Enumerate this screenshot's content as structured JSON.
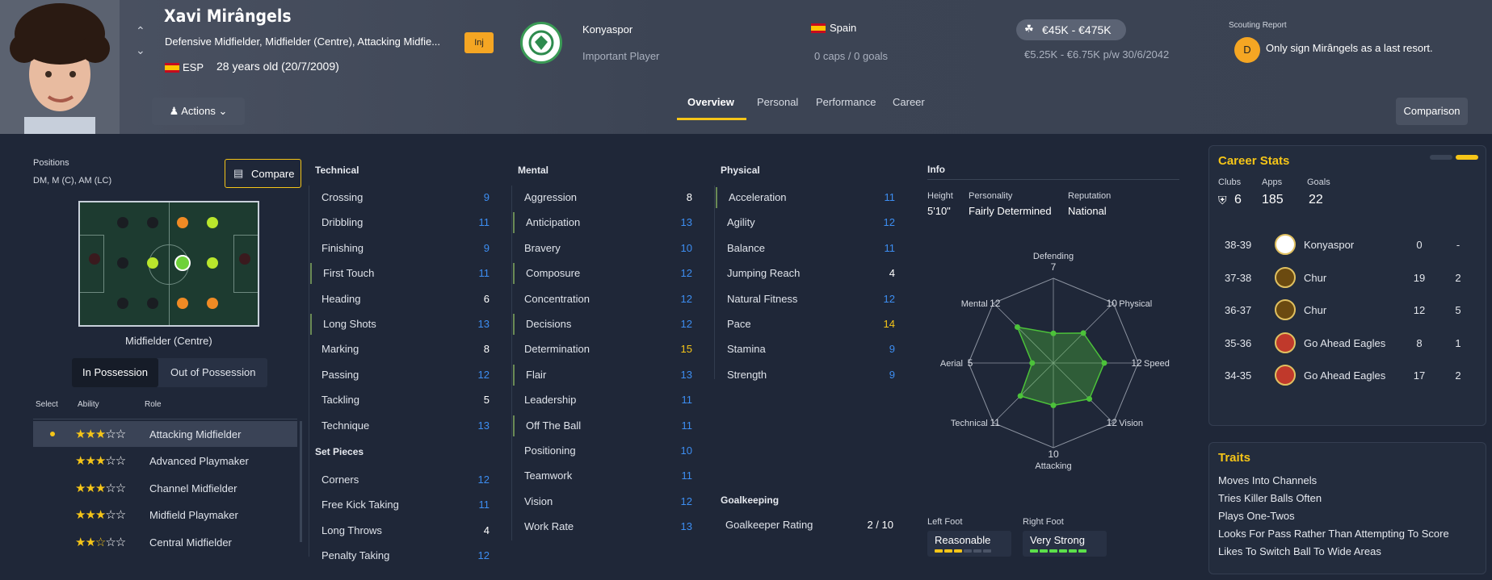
{
  "header": {
    "player_name": "Xavi Mirângels",
    "positions_long": "Defensive Midfielder, Midfielder (Centre), Attacking Midfie...",
    "inj_badge": "Inj",
    "nationality_code": "ESP",
    "age": "28 years old (20/7/2009)",
    "club": "Konyaspor",
    "club_role": "Important Player",
    "nation": "Spain",
    "caps": "0 caps / 0 goals",
    "value": "€45K - €475K",
    "wage": "€5.25K - €6.75K p/w 30/6/2042",
    "scouting_title": "Scouting Report",
    "scout_grade": "D",
    "scout_text": "Only sign Mirângels as a last resort.",
    "actions_label": "Actions",
    "comparison_label": "Comparison",
    "tabs": [
      "Overview",
      "Personal",
      "Performance",
      "Career"
    ]
  },
  "positions": {
    "title": "Positions",
    "list": "DM, M (C), AM (LC)",
    "compare_label": "Compare",
    "current": "Midfielder (Centre)",
    "toggle": [
      "In Possession",
      "Out of Possession"
    ]
  },
  "roles": {
    "headers": [
      "Select",
      "Ability",
      "Role"
    ],
    "items": [
      {
        "name": "Attacking Midfielder",
        "stars": 3
      },
      {
        "name": "Advanced Playmaker",
        "stars": 3
      },
      {
        "name": "Channel Midfielder",
        "stars": 3
      },
      {
        "name": "Midfield Playmaker",
        "stars": 3
      },
      {
        "name": "Central Midfielder",
        "stars": 2.5
      }
    ]
  },
  "technical": {
    "title": "Technical",
    "items": [
      {
        "name": "Crossing",
        "value": "9"
      },
      {
        "name": "Dribbling",
        "value": "11"
      },
      {
        "name": "Finishing",
        "value": "9"
      },
      {
        "name": "First Touch",
        "value": "11"
      },
      {
        "name": "Heading",
        "value": "6"
      },
      {
        "name": "Long Shots",
        "value": "13"
      },
      {
        "name": "Marking",
        "value": "8"
      },
      {
        "name": "Passing",
        "value": "12"
      },
      {
        "name": "Tackling",
        "value": "5"
      },
      {
        "name": "Technique",
        "value": "13"
      }
    ]
  },
  "set_pieces": {
    "title": "Set Pieces",
    "items": [
      {
        "name": "Corners",
        "value": "12"
      },
      {
        "name": "Free Kick Taking",
        "value": "11"
      },
      {
        "name": "Long Throws",
        "value": "4"
      },
      {
        "name": "Penalty Taking",
        "value": "12"
      }
    ]
  },
  "mental": {
    "title": "Mental",
    "items": [
      {
        "name": "Aggression",
        "value": "8"
      },
      {
        "name": "Anticipation",
        "value": "13"
      },
      {
        "name": "Bravery",
        "value": "10"
      },
      {
        "name": "Composure",
        "value": "12"
      },
      {
        "name": "Concentration",
        "value": "12"
      },
      {
        "name": "Decisions",
        "value": "12"
      },
      {
        "name": "Determination",
        "value": "15"
      },
      {
        "name": "Flair",
        "value": "13"
      },
      {
        "name": "Leadership",
        "value": "11"
      },
      {
        "name": "Off The Ball",
        "value": "11"
      },
      {
        "name": "Positioning",
        "value": "10"
      },
      {
        "name": "Teamwork",
        "value": "11"
      },
      {
        "name": "Vision",
        "value": "12"
      },
      {
        "name": "Work Rate",
        "value": "13"
      }
    ]
  },
  "physical": {
    "title": "Physical",
    "items": [
      {
        "name": "Acceleration",
        "value": "11"
      },
      {
        "name": "Agility",
        "value": "12"
      },
      {
        "name": "Balance",
        "value": "11"
      },
      {
        "name": "Jumping Reach",
        "value": "4"
      },
      {
        "name": "Natural Fitness",
        "value": "12"
      },
      {
        "name": "Pace",
        "value": "14"
      },
      {
        "name": "Stamina",
        "value": "9"
      },
      {
        "name": "Strength",
        "value": "9"
      }
    ]
  },
  "goalkeeping": {
    "title": "Goalkeeping",
    "label": "Goalkeeper Rating",
    "value": "2 / 10"
  },
  "info": {
    "title": "Info",
    "height_label": "Height",
    "height": "5'10\"",
    "personality_label": "Personality",
    "personality": "Fairly Determined",
    "reputation_label": "Reputation",
    "reputation": "National",
    "left_foot_label": "Left Foot",
    "left_foot": "Reasonable",
    "left_foot_level": 3,
    "right_foot_label": "Right Foot",
    "right_foot": "Very Strong",
    "right_foot_level": 6
  },
  "radar": {
    "axes": [
      {
        "name": "Defending",
        "value": 7
      },
      {
        "name": "Physical",
        "value": 10
      },
      {
        "name": "Speed",
        "value": 12
      },
      {
        "name": "Vision",
        "value": 12
      },
      {
        "name": "Attacking",
        "value": 10
      },
      {
        "name": "Technical",
        "value": 11
      },
      {
        "name": "Aerial",
        "value": 5
      },
      {
        "name": "Mental",
        "value": 12
      }
    ]
  },
  "career": {
    "title": "Career Stats",
    "clubs_label": "Clubs",
    "clubs": "6",
    "apps_label": "Apps",
    "apps": "185",
    "goals_label": "Goals",
    "goals": "22",
    "rows": [
      {
        "season": "38-39",
        "club": "Konyaspor",
        "apps": "0",
        "goals": "-"
      },
      {
        "season": "37-38",
        "club": "Chur",
        "apps": "19",
        "goals": "2"
      },
      {
        "season": "36-37",
        "club": "Chur",
        "apps": "12",
        "goals": "5"
      },
      {
        "season": "35-36",
        "club": "Go Ahead Eagles",
        "apps": "8",
        "goals": "1"
      },
      {
        "season": "34-35",
        "club": "Go Ahead Eagles",
        "apps": "17",
        "goals": "2"
      }
    ]
  },
  "traits": {
    "title": "Traits",
    "items": [
      "Moves Into Channels",
      "Tries Killer Balls Often",
      "Plays One-Twos",
      "Looks For Pass Rather Than Attempting To Score",
      "Likes To Switch Ball To Wide Areas"
    ]
  },
  "colors": {
    "accent": "#f5c518",
    "attr_blue": "#3d8ef2",
    "radar_green": "#4cc23a"
  }
}
